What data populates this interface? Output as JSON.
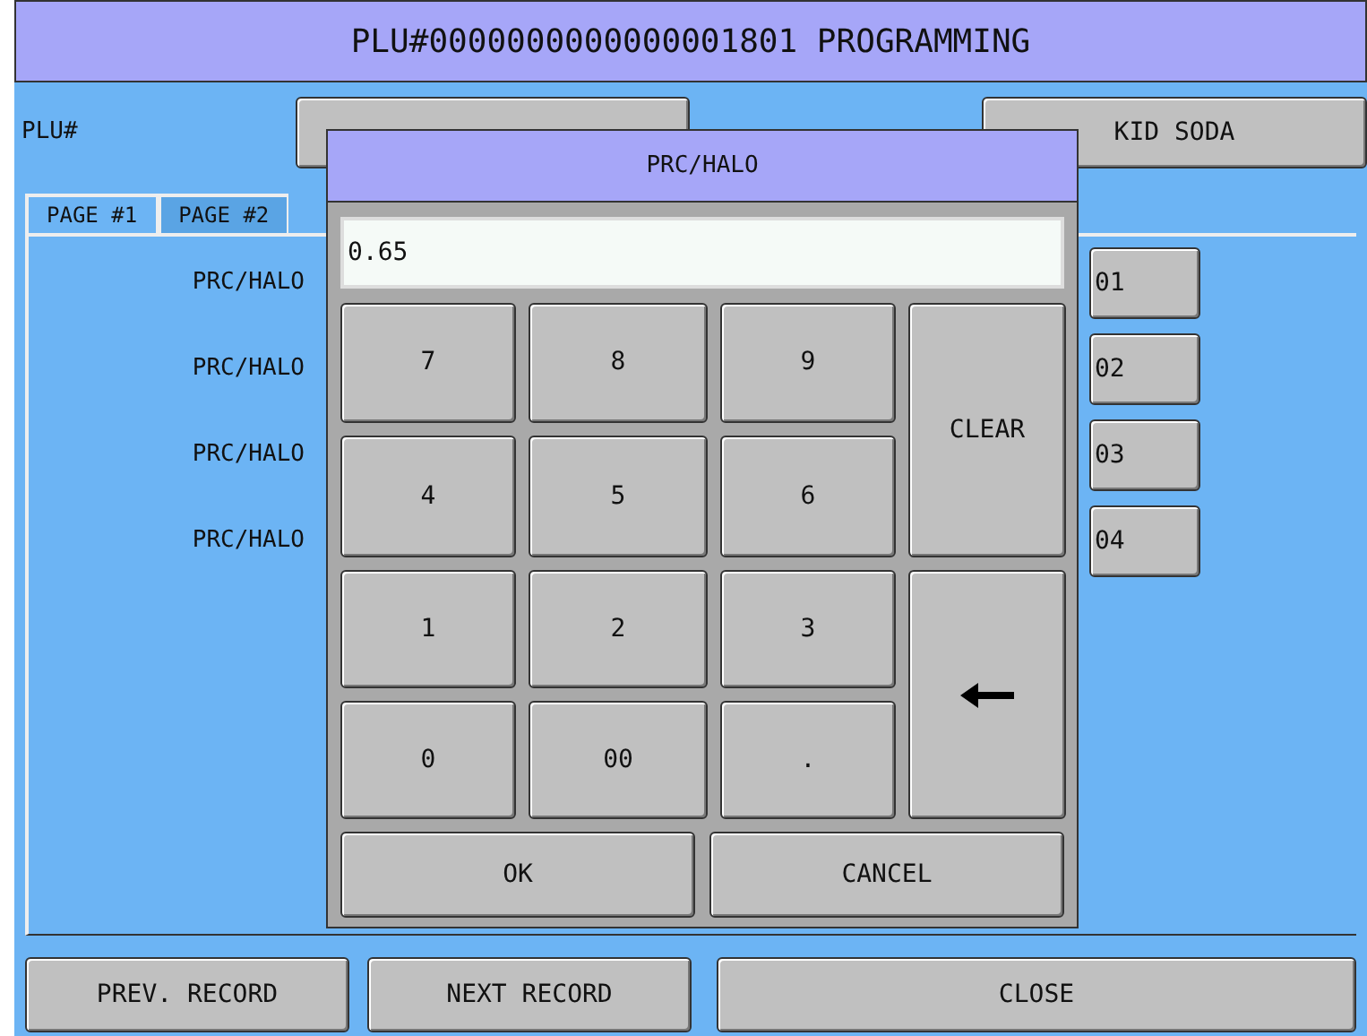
{
  "window": {
    "title": "PLU#0000000000000001801 PROGRAMMING"
  },
  "plu": {
    "label": "PLU#"
  },
  "descriptor": {
    "value": "KID SODA"
  },
  "tabs": [
    {
      "label": "PAGE #1",
      "selected": true
    },
    {
      "label": "PAGE #2",
      "selected": false
    }
  ],
  "rows": [
    {
      "label": "PRC/HALO",
      "value": "01"
    },
    {
      "label": "PRC/HALO",
      "value": "02"
    },
    {
      "label": "PRC/HALO",
      "value": "03"
    },
    {
      "label": "PRC/HALO",
      "value": "04"
    }
  ],
  "dialog": {
    "title": "PRC/HALO",
    "value": "0.65",
    "keys": [
      {
        "kind": "digit",
        "label": "7"
      },
      {
        "kind": "digit",
        "label": "8"
      },
      {
        "kind": "digit",
        "label": "9"
      },
      {
        "kind": "clear",
        "label": "CLEAR"
      },
      {
        "kind": "digit",
        "label": "4"
      },
      {
        "kind": "digit",
        "label": "5"
      },
      {
        "kind": "digit",
        "label": "6"
      },
      {
        "kind": "digit",
        "label": "1"
      },
      {
        "kind": "digit",
        "label": "2"
      },
      {
        "kind": "digit",
        "label": "3"
      },
      {
        "kind": "backspace"
      },
      {
        "kind": "digit",
        "label": "0"
      },
      {
        "kind": "digit",
        "label": "00"
      },
      {
        "kind": "digit",
        "label": "."
      }
    ],
    "actions": [
      "OK",
      "CANCEL"
    ]
  },
  "buttons": [
    "PREV. RECORD",
    "NEXT RECORD",
    "CLOSE"
  ]
}
